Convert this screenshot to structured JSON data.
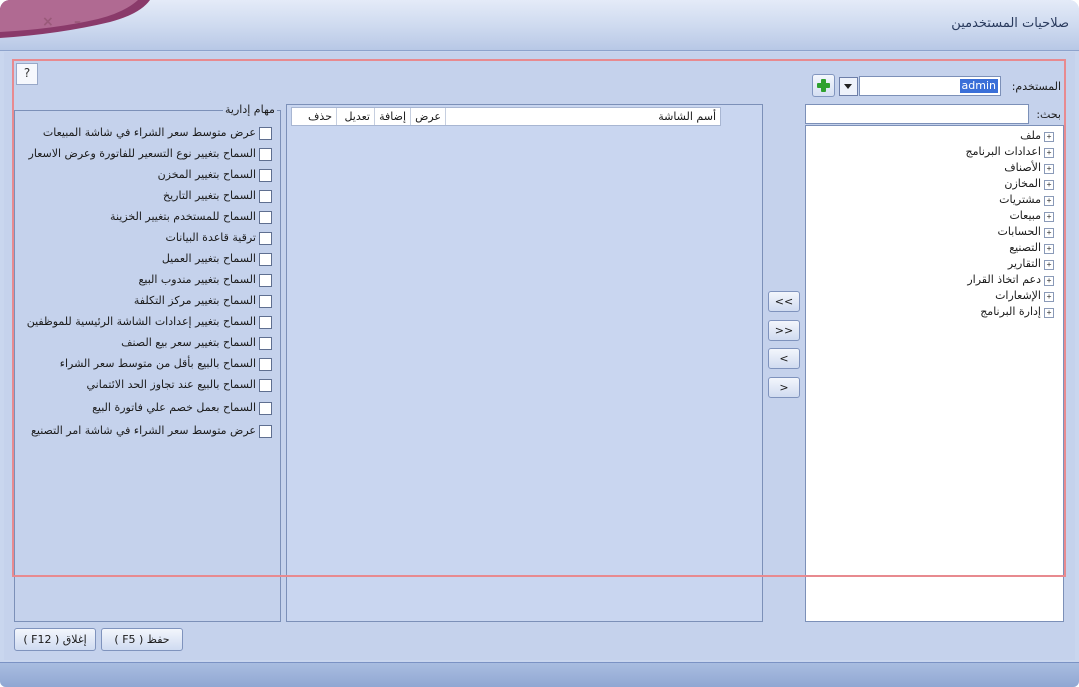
{
  "window": {
    "title": "صلاحيات المستخدمين",
    "close_glyph": "×",
    "minimize_glyph": "–"
  },
  "help": {
    "label": "?"
  },
  "user": {
    "label": "المستخدم:",
    "value": "admin"
  },
  "search": {
    "label": "بحث:",
    "value": ""
  },
  "tree": {
    "items": [
      {
        "label": "ملف"
      },
      {
        "label": "اعدادات البرنامج"
      },
      {
        "label": "الأصناف"
      },
      {
        "label": "المخازن"
      },
      {
        "label": "مشتريات"
      },
      {
        "label": "مبيعات"
      },
      {
        "label": "الحسابات"
      },
      {
        "label": "التصنيع"
      },
      {
        "label": "التقارير"
      },
      {
        "label": "دعم اتخاذ القرار"
      },
      {
        "label": "الإشعارات"
      },
      {
        "label": "إدارة البرنامج"
      }
    ],
    "expander_glyph": "+"
  },
  "transfer_buttons": [
    {
      "label": ">"
    },
    {
      "label": ">>"
    },
    {
      "label": "<"
    },
    {
      "label": "<<"
    }
  ],
  "grid": {
    "columns": [
      {
        "label": "أسم الشاشة"
      },
      {
        "label": "عرض"
      },
      {
        "label": "إضافة"
      },
      {
        "label": "تعديل"
      },
      {
        "label": "حذف"
      }
    ]
  },
  "admin_tasks": {
    "title": "مهام إدارية",
    "items": [
      {
        "label": "عرض متوسط سعر الشراء في شاشة المبيعات",
        "checked": false
      },
      {
        "label": "السماح بتغيير نوع التسعير للفاتورة وعرض الاسعار",
        "checked": false
      },
      {
        "label": "السماح بتغيير المخزن",
        "checked": false
      },
      {
        "label": "السماح بتغيير التاريخ",
        "checked": false
      },
      {
        "label": "السماح للمستخدم بتغيير الخزينة",
        "checked": false
      },
      {
        "label": "ترقية قاعدة البيانات",
        "checked": false
      },
      {
        "label": "السماح بتغيير العميل",
        "checked": false
      },
      {
        "label": "السماح بتغيير مندوب البيع",
        "checked": false
      },
      {
        "label": "السماح بتغيير مركز التكلفة",
        "checked": false
      },
      {
        "label": "السماح بتغيير إعدادات الشاشة الرئيسية للموظفين",
        "checked": false
      },
      {
        "label": "السماح بتغيير سعر بيع الصنف",
        "checked": false
      },
      {
        "label": "السماح بالبيع بأقل من متوسط سعر الشراء",
        "checked": false
      },
      {
        "label": "السماح بالبيع عند تجاوز الحد الائتماني",
        "checked": false
      },
      {
        "label": "السماح بعمل خصم علي فاتورة البيع",
        "checked": false
      },
      {
        "label": "عرض متوسط سعر الشراء في شاشة امر التصنيع",
        "checked": false
      }
    ]
  },
  "actions": {
    "save_label": "حفظ ( F5 )",
    "close_label": "إغلاق ( F12 )"
  }
}
